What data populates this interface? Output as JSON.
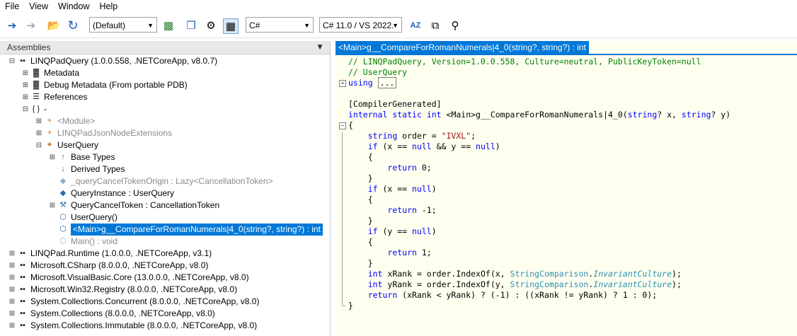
{
  "menu": [
    "File",
    "View",
    "Window",
    "Help"
  ],
  "toolbar": {
    "connection": "(Default)",
    "language": "C#",
    "compiler": "C# 11.0 / VS 2022."
  },
  "left_panel": {
    "title": "Assemblies",
    "pin": "⬍",
    "tree": [
      {
        "level": 0,
        "expander": "⊟",
        "icon": "▪▪",
        "text": "LINQPadQuery (1.0.0.558, .NETCoreApp, v8.0.7)",
        "gray": false
      },
      {
        "level": 1,
        "expander": "⊞",
        "icon": "▓",
        "text": "Metadata",
        "gray": false
      },
      {
        "level": 1,
        "expander": "⊞",
        "icon": "▓",
        "text": "Debug Metadata (From portable PDB)",
        "gray": false
      },
      {
        "level": 1,
        "expander": "⊞",
        "icon": "☰",
        "text": "References",
        "gray": false
      },
      {
        "level": 1,
        "expander": "⊟",
        "icon": "{ }",
        "text": "-",
        "gray": false
      },
      {
        "level": 2,
        "expander": "⊞",
        "icon": "✦",
        "text": "<Module>",
        "gray": true
      },
      {
        "level": 2,
        "expander": "⊞",
        "icon": "✦",
        "text": "LINQPadJsonNodeExtensions",
        "gray": true
      },
      {
        "level": 2,
        "expander": "⊟",
        "icon": "✦",
        "text": "UserQuery",
        "gray": false
      },
      {
        "level": 3,
        "expander": "⊞",
        "icon": "↑",
        "text": "Base Types",
        "gray": false
      },
      {
        "level": 3,
        "expander": "",
        "icon": "↓",
        "text": "Derived Types",
        "gray": false
      },
      {
        "level": 3,
        "expander": "",
        "icon": "◆",
        "text": "_queryCancelTokenOrigin : Lazy<CancellationToken>",
        "gray": true
      },
      {
        "level": 3,
        "expander": "",
        "icon": "◆",
        "text": "QueryInstance : UserQuery",
        "gray": false
      },
      {
        "level": 3,
        "expander": "⊞",
        "icon": "⚒",
        "text": "QueryCancelToken : CancellationToken",
        "gray": false
      },
      {
        "level": 3,
        "expander": "",
        "icon": "⬡",
        "text": "UserQuery()",
        "gray": false
      },
      {
        "level": 3,
        "expander": "",
        "icon": "⬡",
        "text": "<Main>g__CompareForRomanNumerals|4_0(string?, string?) : int",
        "gray": false,
        "selected": true
      },
      {
        "level": 3,
        "expander": "",
        "icon": "⬡",
        "text": "Main() : void",
        "gray": true
      },
      {
        "level": 0,
        "expander": "⊞",
        "icon": "▪▪",
        "text": "LINQPad.Runtime (1.0.0.0, .NETCoreApp, v3.1)",
        "gray": false
      },
      {
        "level": 0,
        "expander": "⊞",
        "icon": "▪▪",
        "text": "Microsoft.CSharp (8.0.0.0, .NETCoreApp, v8.0)",
        "gray": false
      },
      {
        "level": 0,
        "expander": "⊞",
        "icon": "▪▪",
        "text": "Microsoft.VisualBasic.Core (13.0.0.0, .NETCoreApp, v8.0)",
        "gray": false
      },
      {
        "level": 0,
        "expander": "⊞",
        "icon": "▪▪",
        "text": "Microsoft.Win32.Registry (8.0.0.0, .NETCoreApp, v8.0)",
        "gray": false
      },
      {
        "level": 0,
        "expander": "⊞",
        "icon": "▪▪",
        "text": "System.Collections.Concurrent (8.0.0.0, .NETCoreApp, v8.0)",
        "gray": false
      },
      {
        "level": 0,
        "expander": "⊞",
        "icon": "▪▪",
        "text": "System.Collections (8.0.0.0, .NETCoreApp, v8.0)",
        "gray": false
      },
      {
        "level": 0,
        "expander": "⊞",
        "icon": "▪▪",
        "text": "System.Collections.Immutable (8.0.0.0, .NETCoreApp, v8.0)",
        "gray": false
      }
    ]
  },
  "right_panel": {
    "tab_title": "<Main>g__CompareForRomanNumerals|4_0(string?, string?) : int",
    "code": [
      [
        [
          "comment",
          "// LINQPadQuery, Version=1.0.0.558, Culture=neutral, PublicKeyToken=null"
        ]
      ],
      [
        [
          "comment",
          "// UserQuery"
        ]
      ],
      [
        [
          "kw",
          "using"
        ],
        [
          "plain",
          " "
        ],
        [
          "ellipsis",
          "..."
        ]
      ],
      [
        [
          "plain",
          ""
        ]
      ],
      [
        [
          "plain",
          "[CompilerGenerated]"
        ]
      ],
      [
        [
          "kw",
          "internal"
        ],
        [
          "plain",
          " "
        ],
        [
          "kw",
          "static"
        ],
        [
          "plain",
          " "
        ],
        [
          "kw",
          "int"
        ],
        [
          "plain",
          " <Main>g__CompareForRomanNumerals|4_0("
        ],
        [
          "kw",
          "string"
        ],
        [
          "plain",
          "? x, "
        ],
        [
          "kw",
          "string"
        ],
        [
          "plain",
          "? y)"
        ]
      ],
      [
        [
          "plain",
          "{"
        ]
      ],
      [
        [
          "plain",
          "    "
        ],
        [
          "kw",
          "string"
        ],
        [
          "plain",
          " order = "
        ],
        [
          "str",
          "\"IVXL\""
        ],
        [
          "plain",
          ";"
        ]
      ],
      [
        [
          "plain",
          "    "
        ],
        [
          "kw",
          "if"
        ],
        [
          "plain",
          " (x == "
        ],
        [
          "kw",
          "null"
        ],
        [
          "plain",
          " && y == "
        ],
        [
          "kw",
          "null"
        ],
        [
          "plain",
          ")"
        ]
      ],
      [
        [
          "plain",
          "    {"
        ]
      ],
      [
        [
          "plain",
          "        "
        ],
        [
          "kw",
          "return"
        ],
        [
          "plain",
          " 0;"
        ]
      ],
      [
        [
          "plain",
          "    }"
        ]
      ],
      [
        [
          "plain",
          "    "
        ],
        [
          "kw",
          "if"
        ],
        [
          "plain",
          " (x == "
        ],
        [
          "kw",
          "null"
        ],
        [
          "plain",
          ")"
        ]
      ],
      [
        [
          "plain",
          "    {"
        ]
      ],
      [
        [
          "plain",
          "        "
        ],
        [
          "kw",
          "return"
        ],
        [
          "plain",
          " -1;"
        ]
      ],
      [
        [
          "plain",
          "    }"
        ]
      ],
      [
        [
          "plain",
          "    "
        ],
        [
          "kw",
          "if"
        ],
        [
          "plain",
          " (y == "
        ],
        [
          "kw",
          "null"
        ],
        [
          "plain",
          ")"
        ]
      ],
      [
        [
          "plain",
          "    {"
        ]
      ],
      [
        [
          "plain",
          "        "
        ],
        [
          "kw",
          "return"
        ],
        [
          "plain",
          " 1;"
        ]
      ],
      [
        [
          "plain",
          "    }"
        ]
      ],
      [
        [
          "plain",
          "    "
        ],
        [
          "kw",
          "int"
        ],
        [
          "plain",
          " xRank = order."
        ],
        [
          "method",
          "IndexOf"
        ],
        [
          "plain",
          "(x, "
        ],
        [
          "type",
          "StringComparison"
        ],
        [
          "plain",
          "."
        ],
        [
          "typeit",
          "InvariantCulture"
        ],
        [
          "plain",
          ");"
        ]
      ],
      [
        [
          "plain",
          "    "
        ],
        [
          "kw",
          "int"
        ],
        [
          "plain",
          " yRank = order."
        ],
        [
          "method",
          "IndexOf"
        ],
        [
          "plain",
          "(y, "
        ],
        [
          "type",
          "StringComparison"
        ],
        [
          "plain",
          "."
        ],
        [
          "typeit",
          "InvariantCulture"
        ],
        [
          "plain",
          ");"
        ]
      ],
      [
        [
          "plain",
          "    "
        ],
        [
          "kw",
          "return"
        ],
        [
          "plain",
          " (xRank < yRank) ? (-1) : ((xRank != yRank) ? 1 : 0);"
        ]
      ],
      [
        [
          "plain",
          "}"
        ]
      ]
    ]
  }
}
